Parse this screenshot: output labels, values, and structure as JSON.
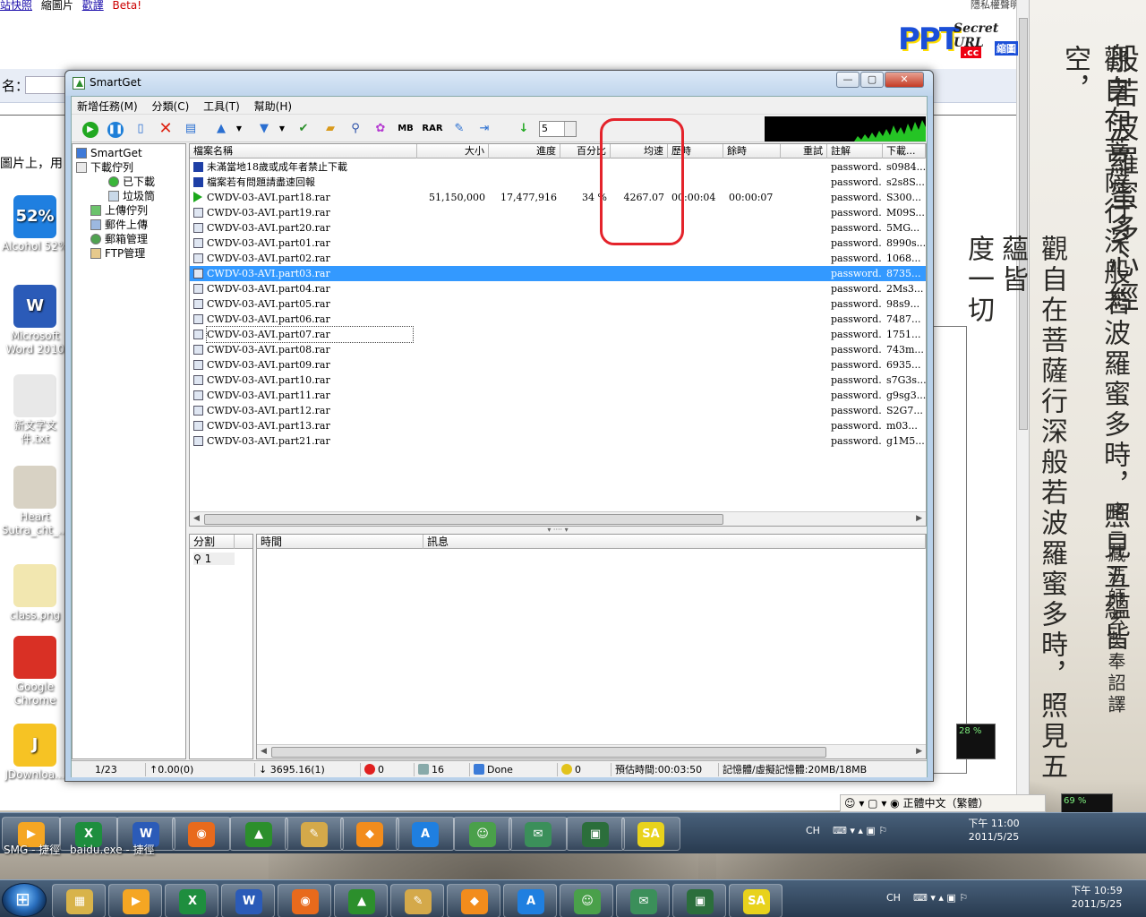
{
  "browser": {
    "links": [
      "站快照",
      "縮圖片",
      "歡譯"
    ],
    "beta": "Beta!",
    "privacy": "隱私權聲明",
    "name_label": "名：",
    "side_text": "圖片上，用"
  },
  "logo": {
    "ppt": "PPT",
    "cc": ".cc",
    "secret": "Secret URL",
    "shrink": "縮圖"
  },
  "calligraphy": {
    "col1": "般若波羅蜜多心經",
    "col2": "觀自在菩薩行深般若波羅蜜多時，照見五蘊皆空，",
    "col3": "唐三藏法師玄奘奉詔譯",
    "col4": "觀自在菩薩行深般若波羅蜜多時，照見五蘊皆",
    "col5": "度一切"
  },
  "desktop_icons": [
    {
      "label": "Alcohol 52%",
      "color": "#1f7fe0",
      "glyph": "52%"
    },
    {
      "label": "Microsoft Word 2010",
      "color": "#2b5bb8",
      "glyph": "W"
    },
    {
      "label": "新文字文件.txt",
      "color": "#e8e8e8",
      "glyph": ""
    },
    {
      "label": "Heart Sutra_cht_...",
      "color": "#d8d2c4",
      "glyph": ""
    },
    {
      "label": "class.png",
      "color": "#f2e7b0",
      "glyph": ""
    },
    {
      "label": "Google Chrome",
      "color": "#d93025",
      "glyph": ""
    },
    {
      "label": "JDownloa...",
      "color": "#f6c324",
      "glyph": "J"
    }
  ],
  "window": {
    "title": "SmartGet",
    "controls": {
      "minimize": "—",
      "maximize": "▢",
      "close": "✕"
    },
    "menu": [
      "新增任務(M)",
      "分類(C)",
      "工具(T)",
      "幫助(H)"
    ],
    "toolbar": {
      "mb": "MB",
      "rar": "RAR",
      "spin_value": "5"
    },
    "tree": {
      "root": "SmartGet",
      "items": [
        "下載佇列",
        "已下載",
        "垃圾筒",
        "上傳佇列",
        "郵件上傳",
        "郵箱管理",
        "FTP管理"
      ]
    },
    "columns": [
      "檔案名稱",
      "大小",
      "進度",
      "百分比",
      "均速",
      "歷時",
      "餘時",
      "重試",
      "註解",
      "下載..."
    ],
    "rows": [
      {
        "name": "未滿當地18歲或成年者禁止下載",
        "size": "",
        "progress": "",
        "pct": "",
        "speed": "",
        "elapsed": "",
        "remain": "",
        "note": "password...",
        "dl": "s0984..."
      },
      {
        "name": "檔案若有問題請盡速回報",
        "size": "",
        "progress": "",
        "pct": "",
        "speed": "",
        "elapsed": "",
        "remain": "",
        "note": "password...",
        "dl": "s2s8S..."
      },
      {
        "name": "CWDV-03-AVI.part18.rar",
        "size": "51,150,000",
        "progress": "17,477,916",
        "pct": "34 %",
        "speed": "4267.07",
        "elapsed": "00:00:04",
        "remain": "00:00:07",
        "note": "password...",
        "dl": "S300..."
      },
      {
        "name": "CWDV-03-AVI.part19.rar",
        "note": "password...",
        "dl": "M09S..."
      },
      {
        "name": "CWDV-03-AVI.part20.rar",
        "note": "password...",
        "dl": "5MG..."
      },
      {
        "name": "CWDV-03-AVI.part01.rar",
        "note": "password...",
        "dl": "8990s..."
      },
      {
        "name": "CWDV-03-AVI.part02.rar",
        "note": "password...",
        "dl": "1068..."
      },
      {
        "name": "CWDV-03-AVI.part03.rar",
        "note": "password...",
        "dl": "8735..."
      },
      {
        "name": "CWDV-03-AVI.part04.rar",
        "note": "password...",
        "dl": "2Ms3..."
      },
      {
        "name": "CWDV-03-AVI.part05.rar",
        "note": "password...",
        "dl": "98s9..."
      },
      {
        "name": "CWDV-03-AVI.part06.rar",
        "note": "password...",
        "dl": "7487..."
      },
      {
        "name": "CWDV-03-AVI.part07.rar",
        "note": "password...",
        "dl": "1751..."
      },
      {
        "name": "CWDV-03-AVI.part08.rar",
        "note": "password...",
        "dl": "743m..."
      },
      {
        "name": "CWDV-03-AVI.part09.rar",
        "note": "password...",
        "dl": "6935..."
      },
      {
        "name": "CWDV-03-AVI.part10.rar",
        "note": "password...",
        "dl": "s7G3s..."
      },
      {
        "name": "CWDV-03-AVI.part11.rar",
        "note": "password...",
        "dl": "g9sg3..."
      },
      {
        "name": "CWDV-03-AVI.part12.rar",
        "note": "password...",
        "dl": "S2G7..."
      },
      {
        "name": "CWDV-03-AVI.part13.rar",
        "note": "password...",
        "dl": "m03..."
      },
      {
        "name": "CWDV-03-AVI.part21.rar",
        "note": "password...",
        "dl": "g1M5..."
      }
    ],
    "selected_row": 7,
    "segment_header": "分割",
    "segment_rows": [
      "1"
    ],
    "log_headers": [
      "時間",
      "訊息"
    ],
    "status": {
      "count": "1/23",
      "upload": "↑0.00(0)",
      "download": "↓ 3695.16(1)",
      "errors": "0",
      "queued": "16",
      "done": "Done",
      "other": "0",
      "eta": "預估時間:00:03:50",
      "memory": "記憶體/虛擬記憶體:20MB/18MB"
    }
  },
  "langbar": {
    "ime": "正體中文（繁體）"
  },
  "gadget1": {
    "cpu": "69 %"
  },
  "gadget2": {
    "cpu": "28 %"
  },
  "taskbar_upper": {
    "labels": [
      "SMG - 捷徑",
      "baidu.exe - 捷徑"
    ],
    "lang": "CH",
    "time": "下午 11:00",
    "date": "2011/5/25"
  },
  "taskbar_lower": {
    "lang": "CH",
    "time": "下午 10:59",
    "date": "2011/5/25"
  },
  "colors": {
    "annotation": "#e4232b",
    "selection": "#3399ff",
    "play": "#1ca81c"
  }
}
